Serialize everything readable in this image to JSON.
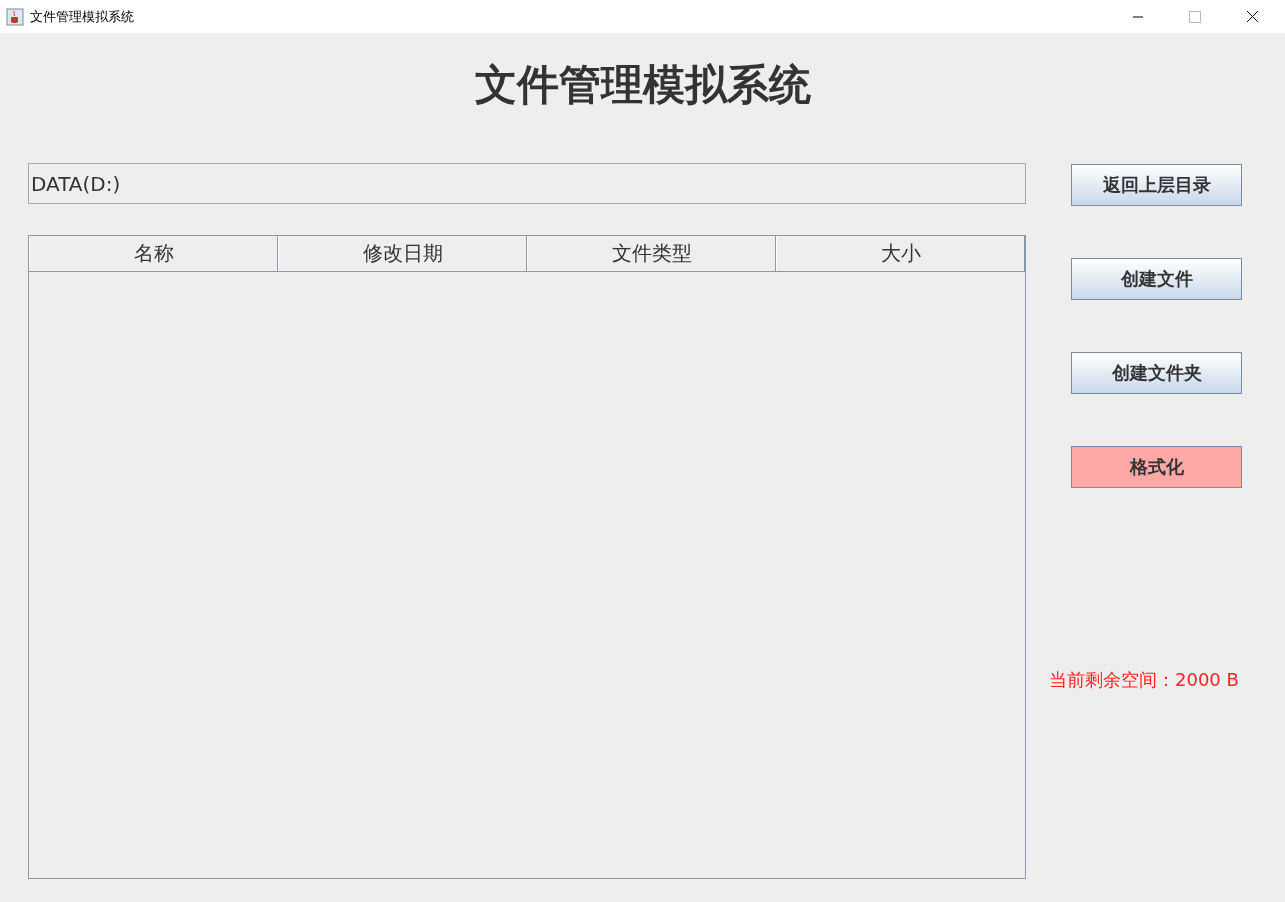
{
  "window": {
    "title": "文件管理模拟系统"
  },
  "heading": "文件管理模拟系统",
  "path_field": {
    "value": "DATA(D:)"
  },
  "table": {
    "columns": [
      "名称",
      "修改日期",
      "文件类型",
      "大小"
    ]
  },
  "buttons": [
    {
      "label": "返回上层目录",
      "kind": "normal"
    },
    {
      "label": "创建文件",
      "kind": "normal"
    },
    {
      "label": "创建文件夹",
      "kind": "normal"
    },
    {
      "label": "格式化",
      "kind": "danger"
    }
  ],
  "status": "当前剩余空间：2000 B"
}
